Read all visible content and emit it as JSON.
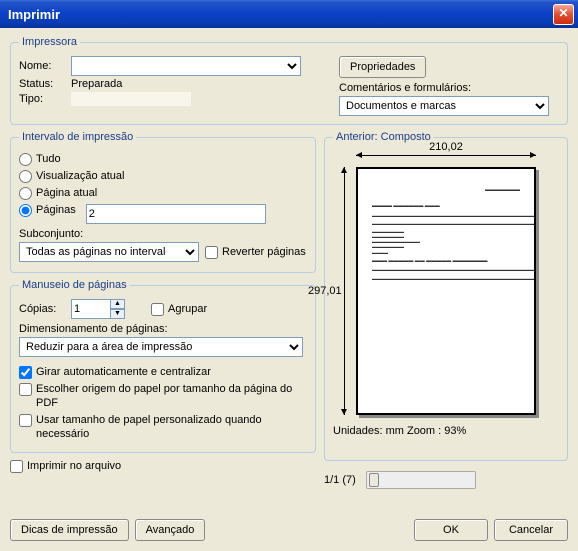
{
  "title": "Imprimir",
  "printer": {
    "legend": "Impressora",
    "name_label": "Nome:",
    "name_value": "",
    "status_label": "Status:",
    "status_value": "Preparada",
    "type_label": "Tipo:",
    "type_value": "",
    "properties_btn": "Propriedades",
    "comments_label": "Comentários e formulários:",
    "comments_value": "Documentos e marcas"
  },
  "range": {
    "legend": "Intervalo de impressão",
    "all": "Tudo",
    "current_view": "Visualização atual",
    "current_page": "Página atual",
    "pages": "Páginas",
    "pages_value": "2",
    "subset_label": "Subconjunto:",
    "subset_value": "Todas as páginas no intervalo",
    "reverse": "Reverter páginas"
  },
  "handling": {
    "legend": "Manuseio de páginas",
    "copies_label": "Cópias:",
    "copies_value": "1",
    "collate": "Agrupar",
    "scaling_label": "Dimensionamento de páginas:",
    "scaling_value": "Reduzir para a área de impressão",
    "auto_rotate": "Girar automaticamente e centralizar",
    "paper_source": "Escolher origem do papel por tamanho da página do PDF",
    "custom_size": "Usar tamanho de papel personalizado quando necessário"
  },
  "print_to_file": "Imprimir no arquivo",
  "preview": {
    "legend": "Anterior: Composto",
    "width": "210,02",
    "height": "297,01",
    "units_zoom": "Unidades: mm Zoom :  93%",
    "page_indicator": "1/1 (7)"
  },
  "buttons": {
    "tips": "Dicas de impressão",
    "advanced": "Avançado",
    "ok": "OK",
    "cancel": "Cancelar"
  }
}
